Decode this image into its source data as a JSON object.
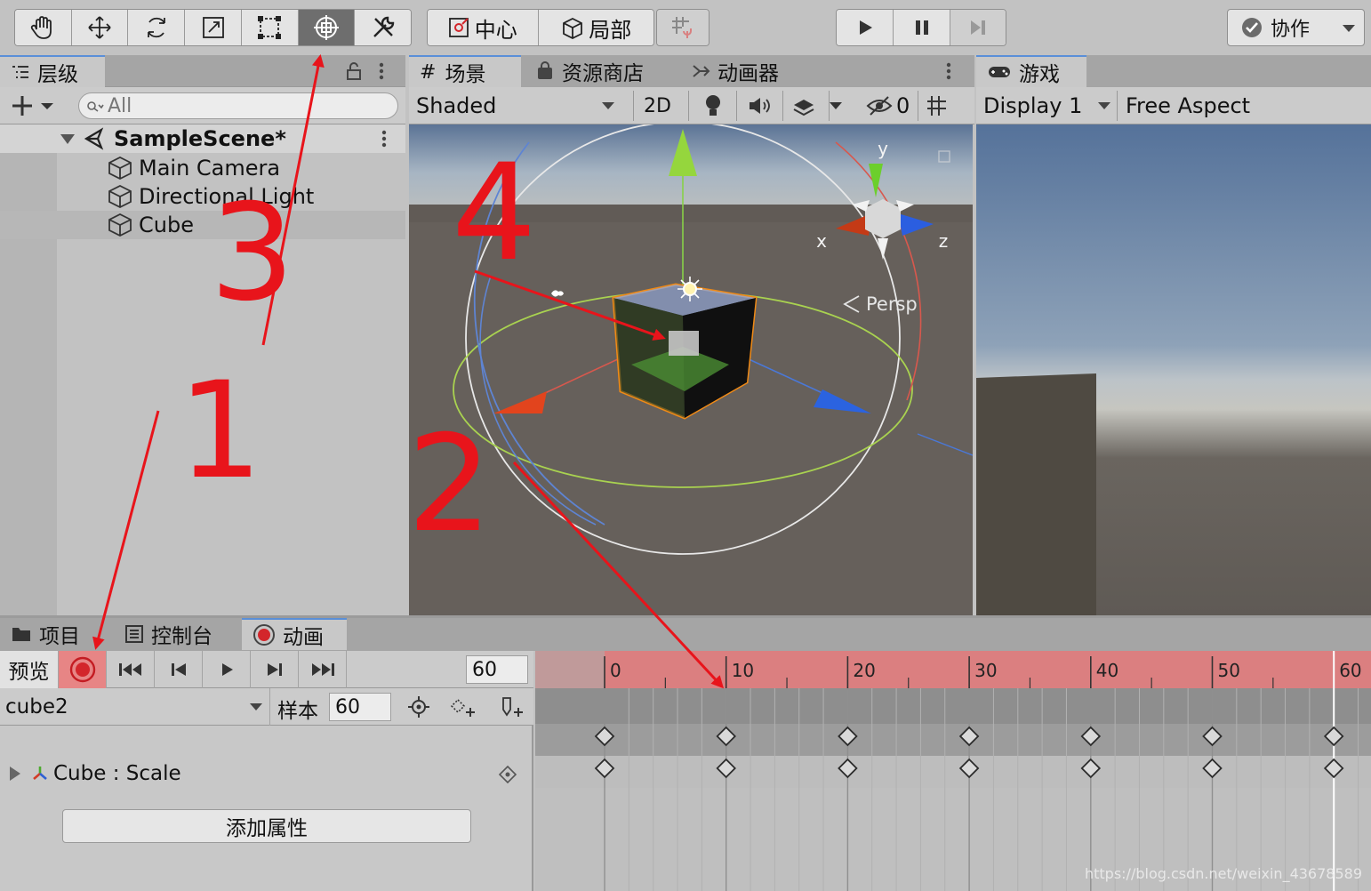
{
  "toolbar": {
    "pivot_label": "中心",
    "space_label": "局部",
    "collab_label": "协作"
  },
  "hierarchy": {
    "tab_label": "层级",
    "search_placeholder": "All",
    "scene_name": "SampleScene*",
    "items": [
      {
        "label": "Main Camera"
      },
      {
        "label": "Directional Light"
      },
      {
        "label": "Cube"
      }
    ]
  },
  "scene": {
    "tabs": [
      {
        "label": "场景"
      },
      {
        "label": "资源商店"
      },
      {
        "label": "动画器"
      }
    ],
    "shading_mode": "Shaded",
    "mode_2d_label": "2D",
    "hidden_count": "0",
    "axis_labels": {
      "x": "x",
      "y": "y",
      "z": "z"
    },
    "persp_label": "Persp"
  },
  "game": {
    "tab_label": "游戏",
    "display": "Display 1",
    "aspect": "Free Aspect"
  },
  "animation": {
    "tabs": [
      {
        "label": "项目"
      },
      {
        "label": "控制台"
      },
      {
        "label": "动画"
      }
    ],
    "preview_label": "预览",
    "current_frame": "60",
    "clip_name": "cube2",
    "samples_label": "样本",
    "samples_value": "60",
    "property_label": "Cube : Scale",
    "add_property_label": "添加属性",
    "ruler_ticks": [
      "0",
      "10",
      "20",
      "30",
      "40",
      "50",
      "60"
    ],
    "keyframes": [
      0,
      10,
      20,
      30,
      40,
      50,
      60
    ]
  },
  "annotations": {
    "numbers": [
      "1",
      "2",
      "3",
      "4"
    ],
    "color": "#e8141b"
  },
  "watermark": "https://blog.csdn.net/weixin_43678589",
  "colors": {
    "accent_selection": "#5a8fd8",
    "record_red": "#d3262b",
    "ruler_red": "#db7f80",
    "sky": "#5b7395",
    "ground": "#66605b"
  }
}
